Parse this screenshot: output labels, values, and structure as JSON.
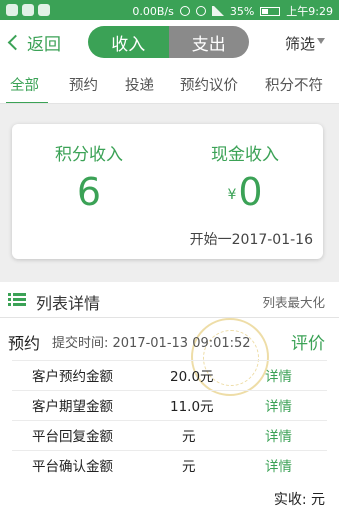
{
  "statusbar": {
    "speed": "0.00B/s",
    "battery": "35%",
    "time": "上午9:29"
  },
  "nav": {
    "back_label": "返回",
    "segments": [
      "收入",
      "支出"
    ],
    "filter_label": "筛选"
  },
  "tabs": [
    "全部",
    "预约",
    "投递",
    "预约议价",
    "积分不符"
  ],
  "summary": {
    "points_label": "积分收入",
    "points_value": "6",
    "cash_label": "现金收入",
    "cash_currency": "¥",
    "cash_value": "0",
    "start_date": "开始一2017-01-16"
  },
  "section": {
    "title": "列表详情",
    "maximize": "列表最大化"
  },
  "record": {
    "type": "预约",
    "submit_time": "提交时间: 2017-01-13 09:01:52",
    "rate_label": "评价",
    "rows": [
      {
        "key": "客户预约金额",
        "value": "20.0元",
        "detail": "详情"
      },
      {
        "key": "客户期望金额",
        "value": "11.0元",
        "detail": "详情"
      },
      {
        "key": "平台回复金额",
        "value": "元",
        "detail": "详情"
      },
      {
        "key": "平台确认金额",
        "value": "元",
        "detail": "详情"
      }
    ],
    "actual": "实收: 元"
  },
  "colors": {
    "accent": "#3ba256",
    "segment_inactive": "#8a8a8a",
    "background": "#eeeeee"
  }
}
